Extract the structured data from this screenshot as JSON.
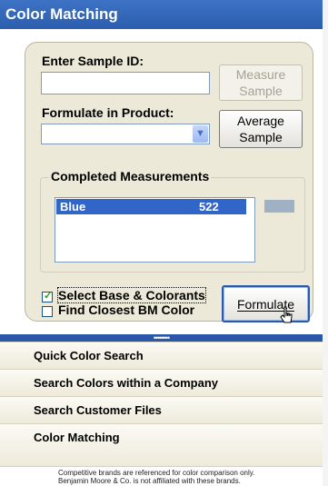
{
  "window": {
    "title": "Color Matching"
  },
  "form": {
    "sample_id_label": "Enter Sample ID:",
    "sample_id_value": "",
    "product_label": "Formulate in Product:",
    "product_value": "",
    "measure_button": "Measure Sample",
    "average_button": "Average Sample"
  },
  "measurements": {
    "label": "Completed Measurements",
    "items": [
      {
        "name": "Blue",
        "value": "522",
        "swatch_color": "#9fb1c3"
      }
    ]
  },
  "options": {
    "select_base_label": "Select Base & Colorants",
    "select_base_checked": true,
    "find_closest_label": "Find Closest BM Color",
    "find_closest_checked": false,
    "formulate_button": "Formulate"
  },
  "splitter": {
    "grip": "••••••••"
  },
  "nav": {
    "items": [
      {
        "label": "Quick Color Search"
      },
      {
        "label": "Search Colors within a Company"
      },
      {
        "label": "Search Customer Files"
      },
      {
        "label": "Color Matching"
      }
    ]
  },
  "footer": {
    "line1": "Competitive brands are referenced for color comparison only.",
    "line2": "Benjamin Moore & Co. is not affiliated with these brands."
  },
  "colors": {
    "accent": "#2b5eae",
    "selection": "#3165c8",
    "panel": "#ece9d8"
  }
}
